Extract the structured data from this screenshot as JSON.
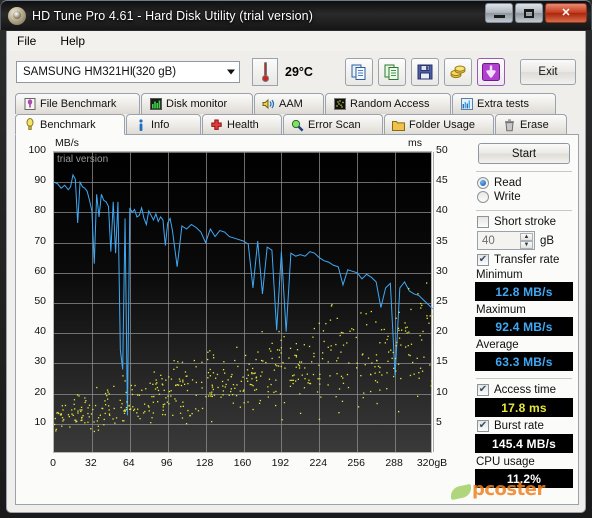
{
  "window": {
    "title": "HD Tune Pro 4.61 - Hard Disk Utility (trial version)",
    "icon": "hdtune-logo-icon",
    "minimize": "–",
    "maximize": "□",
    "close": "✕"
  },
  "menu": {
    "items": [
      {
        "label": "File"
      },
      {
        "label": "Help"
      }
    ]
  },
  "toolbar": {
    "drive": {
      "name": "SAMSUNG HM321HI",
      "capacity": "(320 gB)"
    },
    "temperature": "29°C",
    "buttons": [
      {
        "name": "copy-icon",
        "title": "Copy"
      },
      {
        "name": "copy-to-sheet-icon",
        "title": "Copy to sheet"
      },
      {
        "name": "save-icon",
        "title": "Save"
      },
      {
        "name": "coins-icon",
        "title": "Buy"
      },
      {
        "name": "download-icon",
        "title": "Download"
      }
    ],
    "exit_label": "Exit"
  },
  "tabs": {
    "top_row": [
      {
        "label": "File Benchmark",
        "icon": "file-benchmark-icon",
        "active": false
      },
      {
        "label": "Disk monitor",
        "icon": "disk-monitor-icon",
        "active": false
      },
      {
        "label": "AAM",
        "icon": "speaker-icon",
        "active": false
      },
      {
        "label": "Random Access",
        "icon": "random-access-icon",
        "active": false
      },
      {
        "label": "Extra tests",
        "icon": "extra-tests-icon",
        "active": false
      }
    ],
    "bottom_row": [
      {
        "label": "Benchmark",
        "icon": "benchmark-icon",
        "active": true
      },
      {
        "label": "Info",
        "icon": "info-icon",
        "active": false
      },
      {
        "label": "Health",
        "icon": "health-icon",
        "active": false
      },
      {
        "label": "Error Scan",
        "icon": "error-scan-icon",
        "active": false
      },
      {
        "label": "Folder Usage",
        "icon": "folder-usage-icon",
        "active": false
      },
      {
        "label": "Erase",
        "icon": "erase-icon",
        "active": false
      }
    ]
  },
  "side_panel": {
    "start_label": "Start",
    "mode": {
      "read_label": "Read",
      "write_label": "Write",
      "selected": "Read"
    },
    "short_stroke": {
      "label": "Short stroke",
      "checked": false,
      "value": "40",
      "unit": "gB"
    },
    "transfer_rate": {
      "label": "Transfer rate",
      "checked": true
    },
    "minimum_label": "Minimum",
    "minimum_value": "12.8 MB/s",
    "maximum_label": "Maximum",
    "maximum_value": "92.4 MB/s",
    "average_label": "Average",
    "average_value": "63.3 MB/s",
    "access_time": {
      "label": "Access time",
      "checked": true,
      "value": "17.8 ms"
    },
    "burst_rate": {
      "label": "Burst rate",
      "checked": true,
      "value": "145.4 MB/s"
    },
    "cpu_usage": {
      "label": "CPU usage",
      "value": "11.2%"
    }
  },
  "watermark": {
    "text": "pcoster"
  },
  "chart_data": {
    "type": "line",
    "title": "",
    "overlay_text": "trial version",
    "xlabel": "",
    "ylabel": "MB/s",
    "y2label": "ms",
    "xlim": [
      0,
      320
    ],
    "ylim": [
      0,
      100
    ],
    "y2lim": [
      0,
      50
    ],
    "xticks": [
      0,
      32,
      64,
      96,
      128,
      160,
      192,
      224,
      256,
      288,
      320
    ],
    "xtick_labels": [
      "0",
      "32",
      "64",
      "96",
      "128",
      "160",
      "192",
      "224",
      "256",
      "288",
      "320gB"
    ],
    "yticks": [
      10,
      20,
      30,
      40,
      50,
      60,
      70,
      80,
      90,
      100
    ],
    "y2ticks": [
      5,
      10,
      15,
      20,
      25,
      30,
      35,
      40,
      45,
      50
    ],
    "grid": true,
    "legend": "none",
    "series": [
      {
        "name": "Transfer rate",
        "color": "#3fa9f5",
        "axis": "left",
        "units": "MB/s",
        "x": [
          0,
          3,
          6,
          9,
          12,
          14,
          16,
          18,
          20,
          22,
          24,
          26,
          28,
          30,
          32,
          34,
          36,
          38,
          40,
          42,
          44,
          46,
          48,
          50,
          52,
          54,
          56,
          58,
          60,
          62,
          64,
          66,
          68,
          70,
          72,
          74,
          76,
          78,
          80,
          82,
          84,
          86,
          88,
          90,
          92,
          94,
          96,
          98,
          100,
          104,
          108,
          112,
          116,
          120,
          124,
          128,
          132,
          136,
          140,
          144,
          148,
          152,
          156,
          160,
          164,
          168,
          172,
          176,
          180,
          184,
          188,
          192,
          196,
          200,
          204,
          208,
          212,
          216,
          220,
          224,
          228,
          232,
          236,
          240,
          244,
          248,
          252,
          256,
          260,
          264,
          268,
          272,
          276,
          280,
          284,
          288,
          292,
          296,
          300,
          304,
          308,
          312,
          316,
          320
        ],
        "y": [
          90.0,
          89.5,
          88.0,
          89.0,
          87.5,
          88.5,
          92.4,
          91.0,
          76.5,
          90.0,
          88.5,
          88.0,
          87.0,
          84.0,
          80.5,
          63.0,
          86.0,
          78.5,
          86.0,
          84.0,
          83.5,
          82.0,
          67.0,
          83.5,
          66.5,
          83.5,
          34.5,
          28.0,
          78.0,
          12.8,
          81.5,
          80.0,
          81.0,
          78.5,
          79.0,
          81.5,
          78.0,
          76.0,
          80.5,
          79.0,
          77.5,
          79.5,
          77.0,
          78.5,
          77.5,
          69.0,
          76.5,
          78.0,
          74.0,
          62.0,
          75.5,
          74.5,
          76.0,
          75.0,
          73.5,
          70.0,
          74.5,
          72.0,
          74.0,
          73.5,
          72.0,
          71.5,
          71.0,
          70.5,
          69.5,
          55.0,
          70.5,
          53.0,
          68.5,
          67.5,
          41.0,
          67.0,
          40.5,
          66.5,
          65.5,
          66.0,
          65.5,
          67.0,
          66.5,
          65.0,
          64.0,
          63.5,
          62.5,
          62.0,
          56.0,
          61.0,
          60.5,
          60.0,
          58.0,
          59.5,
          58.5,
          57.0,
          48.5,
          55.0,
          56.5,
          26.0,
          55.0,
          57.0,
          54.0,
          53.0,
          52.5,
          51.0,
          49.5,
          48.0
        ]
      },
      {
        "name": "Access time",
        "color": "#e8e83a",
        "axis": "right",
        "units": "ms",
        "mean_ms": 17.8,
        "description": "Scattered yellow dots, access time samples rising from ~5 ms near 0 gB to ~20-24 ms near 320 gB"
      }
    ]
  }
}
